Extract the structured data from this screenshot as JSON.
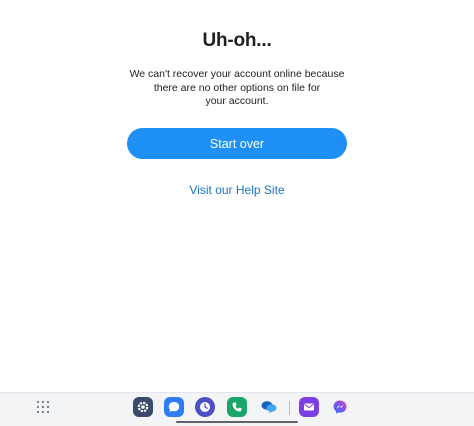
{
  "dialog": {
    "title": "Uh-oh...",
    "message": "We can't recover your account online because\nthere are no other options on file for\nyour account.",
    "start_over_label": "Start over",
    "help_link_label": "Visit our Help Site"
  },
  "taskbar": {
    "apps": [
      {
        "name": "apps-grid-icon"
      },
      {
        "name": "settings-icon",
        "color": "#3b4a6b"
      },
      {
        "name": "messages-icon",
        "color": "#2f7df6"
      },
      {
        "name": "clock-icon",
        "color": "#4b4fc3"
      },
      {
        "name": "phone-icon",
        "color": "#1aa56b"
      },
      {
        "name": "chat-bubbles-icon",
        "color": "#1565c0"
      },
      {
        "name": "email-icon",
        "color": "#7b3fe4"
      },
      {
        "name": "messenger-icon",
        "color": "#8a4cf0"
      }
    ]
  },
  "colors": {
    "accent": "#1e90f5",
    "link": "#1a73c9"
  }
}
